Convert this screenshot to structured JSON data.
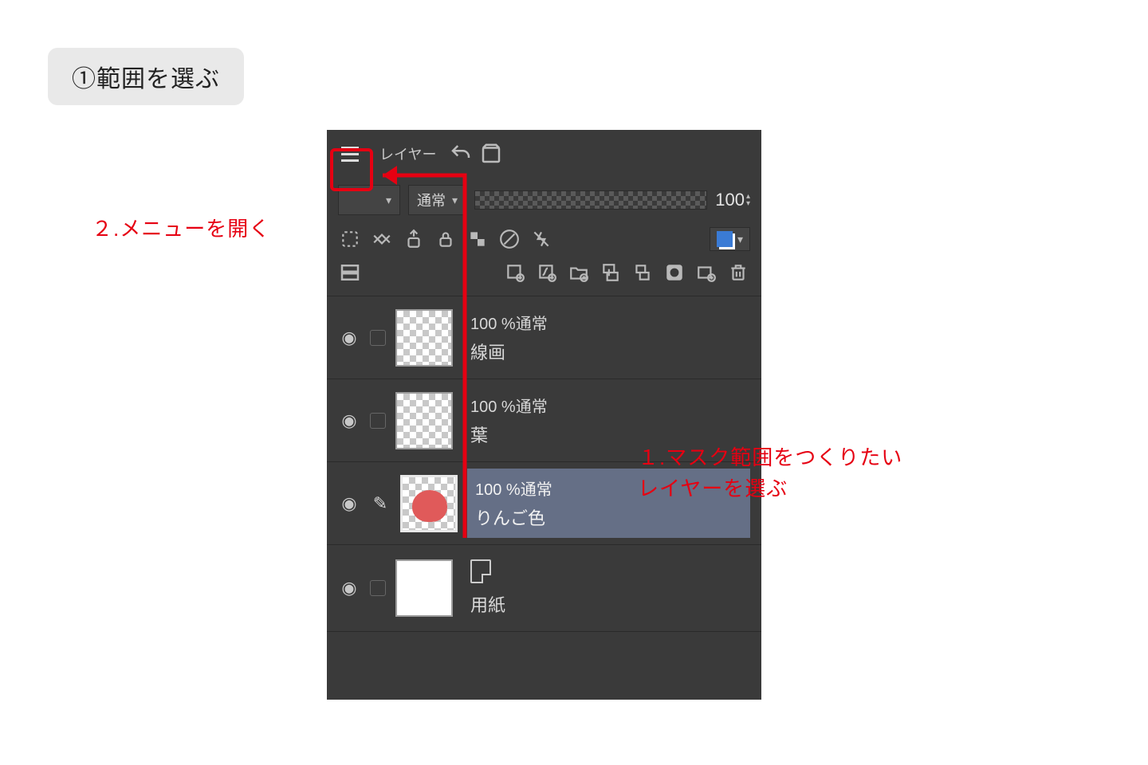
{
  "badge": {
    "text": "①範囲を選ぶ"
  },
  "callouts": {
    "openMenu": "２.メニューを開く",
    "chooseLayer1": "１.マスク範囲をつくりたい",
    "chooseLayer2": "レイヤーを選ぶ"
  },
  "panel": {
    "tabLabel": "レイヤー",
    "blendMode": "通常",
    "opacityValue": "100"
  },
  "layers": [
    {
      "opacity": "100 %通常",
      "name": "線画"
    },
    {
      "opacity": "100 %通常",
      "name": "葉"
    },
    {
      "opacity": "100 %通常",
      "name": "りんご色"
    },
    {
      "name": "用紙"
    }
  ]
}
